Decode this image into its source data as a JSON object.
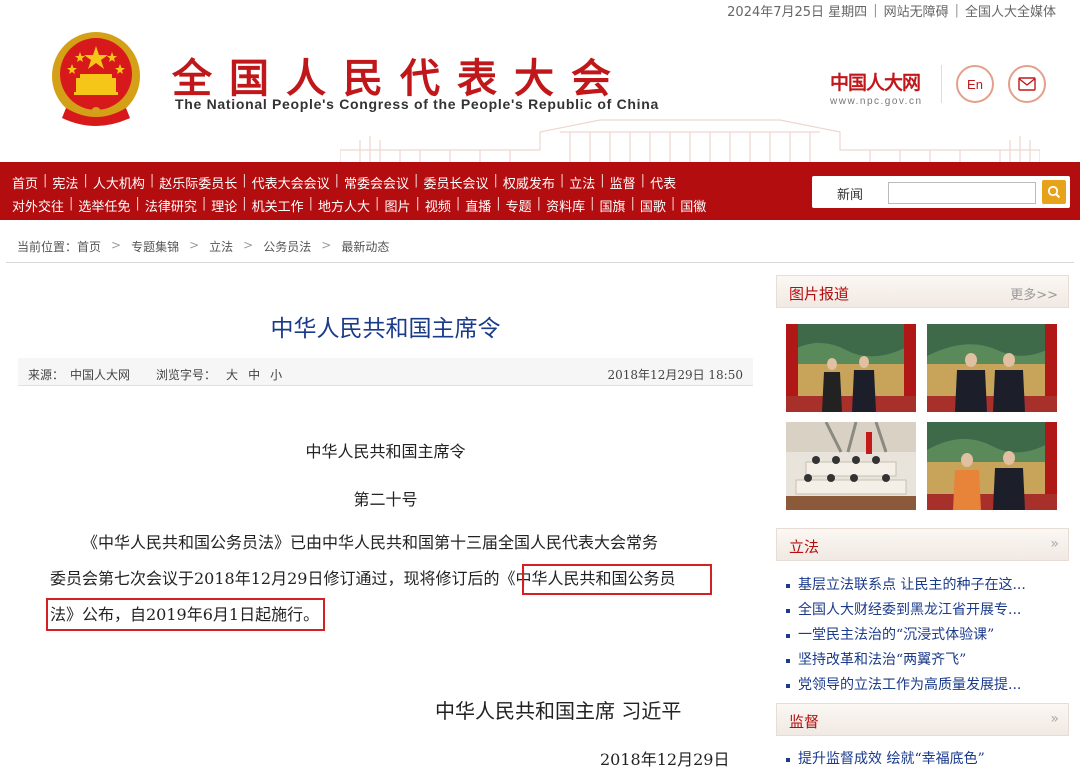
{
  "topbar": {
    "date": "2024年7月25日 星期四",
    "accessibility": "网站无障碍",
    "media": "全国人大全媒体"
  },
  "header": {
    "title_cn": "全国人民代表大会",
    "title_en": "The National People's Congress of the People's Republic of China",
    "logo_cn": "中国人大网",
    "logo_url": "www.npc.gov.cn",
    "en_button": "En",
    "mail_icon": "mail-icon"
  },
  "nav": {
    "row1": [
      "首页",
      "宪法",
      "人大机构",
      "赵乐际委员长",
      "代表大会会议",
      "常委会会议",
      "委员长会议",
      "权威发布",
      "立法",
      "监督",
      "代表"
    ],
    "row2": [
      "对外交往",
      "选举任免",
      "法律研究",
      "理论",
      "机关工作",
      "地方人大",
      "图片",
      "视频",
      "直播",
      "专题",
      "资料库",
      "国旗",
      "国歌",
      "国徽"
    ],
    "search_label": "新闻",
    "search_placeholder": ""
  },
  "breadcrumb": [
    "当前位置：首页",
    "专题集锦",
    "立法",
    "公务员法",
    "最新动态"
  ],
  "article": {
    "title": "中华人民共和国主席令",
    "source_label": "来源：",
    "source": "中国人大网",
    "font_label": "浏览字号：",
    "font_sizes": [
      "大",
      "中",
      "小"
    ],
    "datetime": "2018年12月29日  18:50",
    "heading": "中华人民共和国主席令",
    "number": "第二十号",
    "lines": [
      "《中华人民共和国公务员法》已由中华人民共和国第十三届全国人民代表大会常务",
      "委员会第七次会议于2018年12月29日修订通过，现将修订后的《中华人民共和国公务员",
      "法》公布，自2019年6月1日起施行。"
    ],
    "signature": "中华人民共和国主席  习近平",
    "sign_date": "2018年12月29日"
  },
  "sidebar": {
    "photos_title": "图片报道",
    "more": "更多>>",
    "legislation_title": "立法",
    "legislation_items": [
      "基层立法联系点 让民主的种子在这...",
      "全国人大财经委到黑龙江省开展专...",
      "一堂民主法治的“沉浸式体验课”",
      "坚持改革和法治“两翼齐飞”",
      "党领导的立法工作为高质量发展提..."
    ],
    "supervision_title": "监督",
    "supervision_items": [
      "提升监督成效 绘就“幸福底色”"
    ],
    "chevron": "»"
  },
  "colors": {
    "brand_red": "#b40d0f",
    "link_blue": "#1a3a8a",
    "highlight": "#d42020"
  }
}
